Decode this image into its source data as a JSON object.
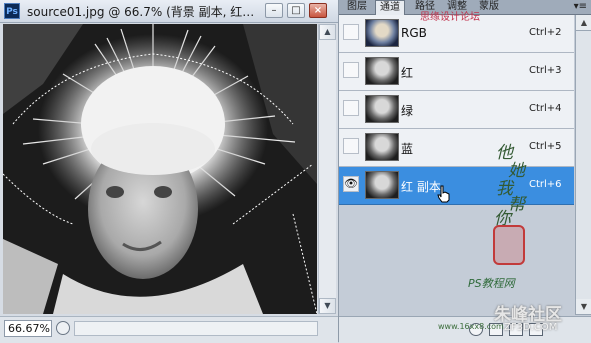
{
  "document": {
    "app_icon_text": "Ps",
    "title": "source01.jpg @ 66.7% (背景 副本, 红…",
    "zoom": "66.67%"
  },
  "panel": {
    "tabs": [
      "图层",
      "通道",
      "路径",
      "调整",
      "蒙版"
    ],
    "active_tab": "通道",
    "menu_glyph": "▾≡",
    "channels": [
      {
        "name": "RGB",
        "shortcut": "Ctrl+2",
        "visible": false,
        "selected": false
      },
      {
        "name": "红",
        "shortcut": "Ctrl+3",
        "visible": false,
        "selected": false
      },
      {
        "name": "绿",
        "shortcut": "Ctrl+4",
        "visible": false,
        "selected": false
      },
      {
        "name": "蓝",
        "shortcut": "Ctrl+5",
        "visible": false,
        "selected": false
      },
      {
        "name": "红 副本",
        "shortcut": "Ctrl+6",
        "visible": true,
        "selected": true
      }
    ],
    "eye_glyph": "👁"
  },
  "watermark": {
    "top": "思缘设计论坛",
    "calligraphy": [
      "他",
      "她",
      "我",
      "帮",
      "你"
    ],
    "ps_line": "PS教程网",
    "site": "朱峰社区",
    "domain": "ZF3D.COM",
    "small": "www.16xx8.com"
  },
  "colors": {
    "selected_row": "#3b8ee0",
    "panel_bg": "#c4ccd7",
    "close_button": "#c8553f"
  }
}
